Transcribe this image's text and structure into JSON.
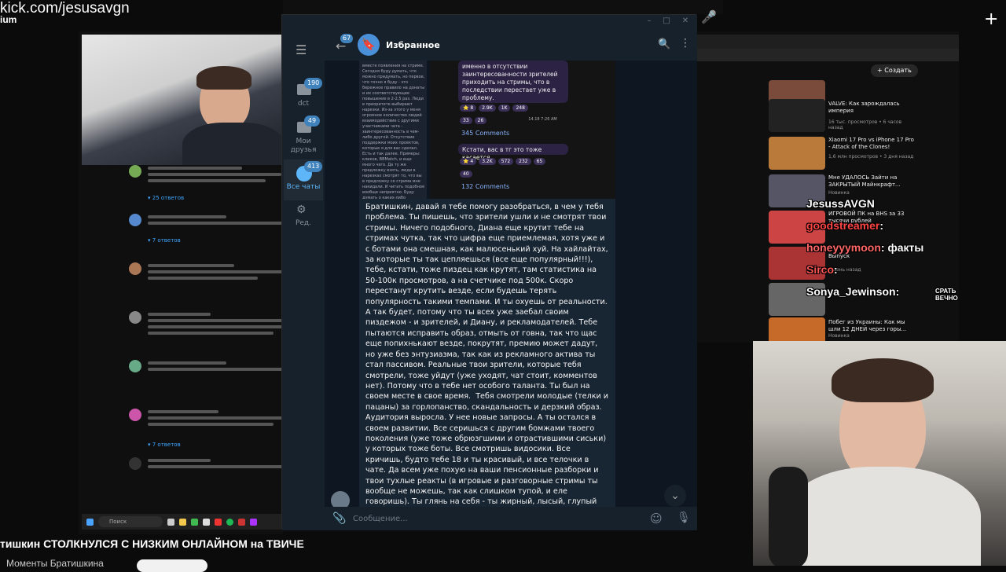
{
  "stream": {
    "watermark": "kick.com/jesusavgn",
    "watermark_sub": "ium"
  },
  "video": {
    "title": "тишкин СТОЛКНУЛСЯ С НИЗКИМ ОНЛАЙНОМ на ТВИЧЕ",
    "channel": "Моменты Братишкина"
  },
  "taskbar": {
    "search_placeholder": "Поиск"
  },
  "telegram": {
    "window_controls": [
      "–",
      "□",
      "✕"
    ],
    "sidebar": {
      "folders": [
        {
          "label": "dct",
          "badge": "190"
        },
        {
          "label": "Мои друзья",
          "badge": "49"
        },
        {
          "label": "Все чаты",
          "badge": "413"
        }
      ],
      "edit_label": "Ред."
    },
    "header": {
      "back_badge": "67",
      "title": "Избранное"
    },
    "forwarded": {
      "left_text": "вместе появления на стриме. Сегодня буду думать, что можно придумать, но первое, что точно я буду - это бережное правило на донаты и их соответствующее повышение в 2-2,5 раз.\n\nЛюди в приоритете выбирают нарезки. Из-за этого у меня огромное количество людей взаимодействие с другими участниками чата - заинтересованность в чем-либо другой. Отсутствие поддержки моих проектов, которые я для вас сделал. Есть и так далее. Примеры: кликов, ВВМatch, и еще много чего. Да ту же предложку взять, люди в нарезках смотрят то, что вы в предложку со стрима мне накидали. И читать подобное вообще неприятно. Буду думать о каких-либо ограничениях сегодня на стриме. Надеюсь поможет с идеями.",
      "msg1": "именно в отсутствии заинтересованности зрителей приходить на стримы, что в последствии перестает уже в проблему.",
      "reactions1": [
        "⭐ 8",
        "2.9K",
        "1K",
        "248",
        "33",
        "26"
      ],
      "comments1": "345 Comments",
      "time1": "14.18 7:26 AM",
      "msg2": "Кстати, вас в тг это тоже касается.",
      "reactions2": [
        "⭐ 4",
        "3.2K",
        "572",
        "232",
        "65",
        "40"
      ],
      "comments2": "132 Comments"
    },
    "message": "Братишкин, давай я тебе помогу разобраться, в чем у тебя проблема. Ты пишешь, что зрители ушли и не смотрят твои стримы. Ничего подобного, Диана еще крутит тебе на стримах чутка, так что цифра еще приемлемая, хотя уже и с ботами она смешная, как малюсенький хуй. На хайлайтах, за которые ты так цепляешься (все еще популярный!!!), тебе, кстати, тоже пиздец как крутят, там статистика на 50-100к просмотров, а на счетчике под 500к. Скоро перестанут крутить везде, если будешь терять популярность такими темпами. И ты охуешь от реальности. А так будет, потому что ты всех уже заебал своим пиздежом - и зрителей, и Диану, и рекламодателей. Тебе пытаются исправить образ, отмыть от говна, так что щас еще попихнькают везде, покрутят, премию может дадут, но уже без энтузиазма, так как из рекламного актива ты стал пассивом. Реальные твои зрители, которые тебя смотрели, тоже уйдут (уже уходят, чат стоит, комментов нет). Потому что в тебе нет особого таланта. Ты был на своем месте в свое время.  Тебя смотрели молодые (телки и пацаны) за горлопанство, скандальность и дерзкий образ. Аудитория выросла. У нее новые запросы. А ты остался в своем развитии. Все серишься с другим бомжами твоего поколения (уже тоже обрюзгшими и отрастившими сиськи) у которых тоже боты. Все смотришь видосики. Все кричишь, будто тебе 18 и ты красивый, и все телочки в чате. Да всем уже похую на ваши пенсионные разборки и твои тухлые реакты (в игровые и разговорные стримы ты вообще не можешь, так как слишком тупой, и еле говоришь). Ты глянь на себя - ты жирный, лысый, глупый старый хуй. И ты пытаешься в актуалочку?? Не, брат, зумеры такое смотреть не хотят. Бабы уже кринж ловят с тебя. Современные молодые выбирают новых фреш старов, а твои",
    "input_placeholder": "Сообщение..."
  },
  "youtube_right": {
    "create_label": "+ Создать",
    "recommendations": [
      {
        "title": "VALVE: Как зарождалась империя",
        "meta": "16 тыс. просмотров • 6 часов назад"
      },
      {
        "title": "Xiaomi 17 Pro vs iPhone 17 Pro - Attack of the Clones!",
        "meta": "1,6 млн просмотров • 3 дня назад"
      },
      {
        "title": "Мне УДАЛОСЬ Зайти на ЗАКРЫТЫЙ Майнкрафт...",
        "meta": "Новинка"
      },
      {
        "title": "ИГРОВОЙ ПК на ВНS за 33 тысячи рублей",
        "meta": "34 тыс. просмотров"
      },
      {
        "title": "Выпуск",
        "meta": "1 день назад"
      },
      {
        "title": "Побег из Украины: Как мы шли 12 ДНЕЙ через горы...",
        "meta": "Новинка"
      }
    ]
  },
  "chat": [
    {
      "name": "JesussAVGN",
      "text": "",
      "color": "#ffffff"
    },
    {
      "name": "goodstreamer",
      "text": ":",
      "color": "#ff4444"
    },
    {
      "name": "honeyyymoon",
      "text": ": факты",
      "color": "#ff6666"
    },
    {
      "name": "Sirco",
      "text": ":",
      "color": "#ff5555"
    },
    {
      "name": "Sonya_Jewinson",
      "text": ":",
      "color": "#ffffff"
    }
  ],
  "chat_extra": "СРАТЬ ВЕЧНО"
}
